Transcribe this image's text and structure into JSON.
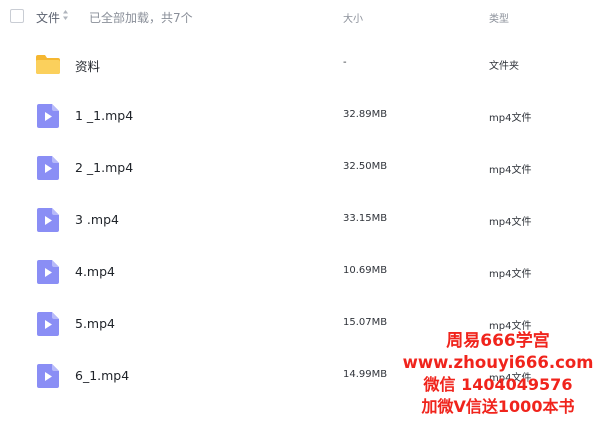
{
  "header": {
    "name_label": "文件",
    "loaded_text": "已全部加载，共7个",
    "size_label": "大小",
    "type_label": "类型"
  },
  "files": [
    {
      "name": "资料",
      "size": "-",
      "type": "文件夹",
      "icon": "folder-icon"
    },
    {
      "name": "1 _1.mp4",
      "size": "32.89MB",
      "type": "mp4文件",
      "icon": "video-file-icon"
    },
    {
      "name": "2 _1.mp4",
      "size": "32.50MB",
      "type": "mp4文件",
      "icon": "video-file-icon"
    },
    {
      "name": "3 .mp4",
      "size": "33.15MB",
      "type": "mp4文件",
      "icon": "video-file-icon"
    },
    {
      "name": "4.mp4",
      "size": "10.69MB",
      "type": "mp4文件",
      "icon": "video-file-icon"
    },
    {
      "name": "5.mp4",
      "size": "15.07MB",
      "type": "mp4文件",
      "icon": "video-file-icon"
    },
    {
      "name": "6_1.mp4",
      "size": "14.99MB",
      "type": "mp4文件",
      "icon": "video-file-icon"
    }
  ],
  "watermark": {
    "line1": "周易666学宫",
    "line2": "www.zhouyi666.com",
    "line3": "微信 1404049576",
    "line4": "加微V信送1000本书"
  },
  "colors": {
    "folder": "#f9c84a",
    "video_icon": "#8a8ef5",
    "watermark": "#f0241c"
  }
}
